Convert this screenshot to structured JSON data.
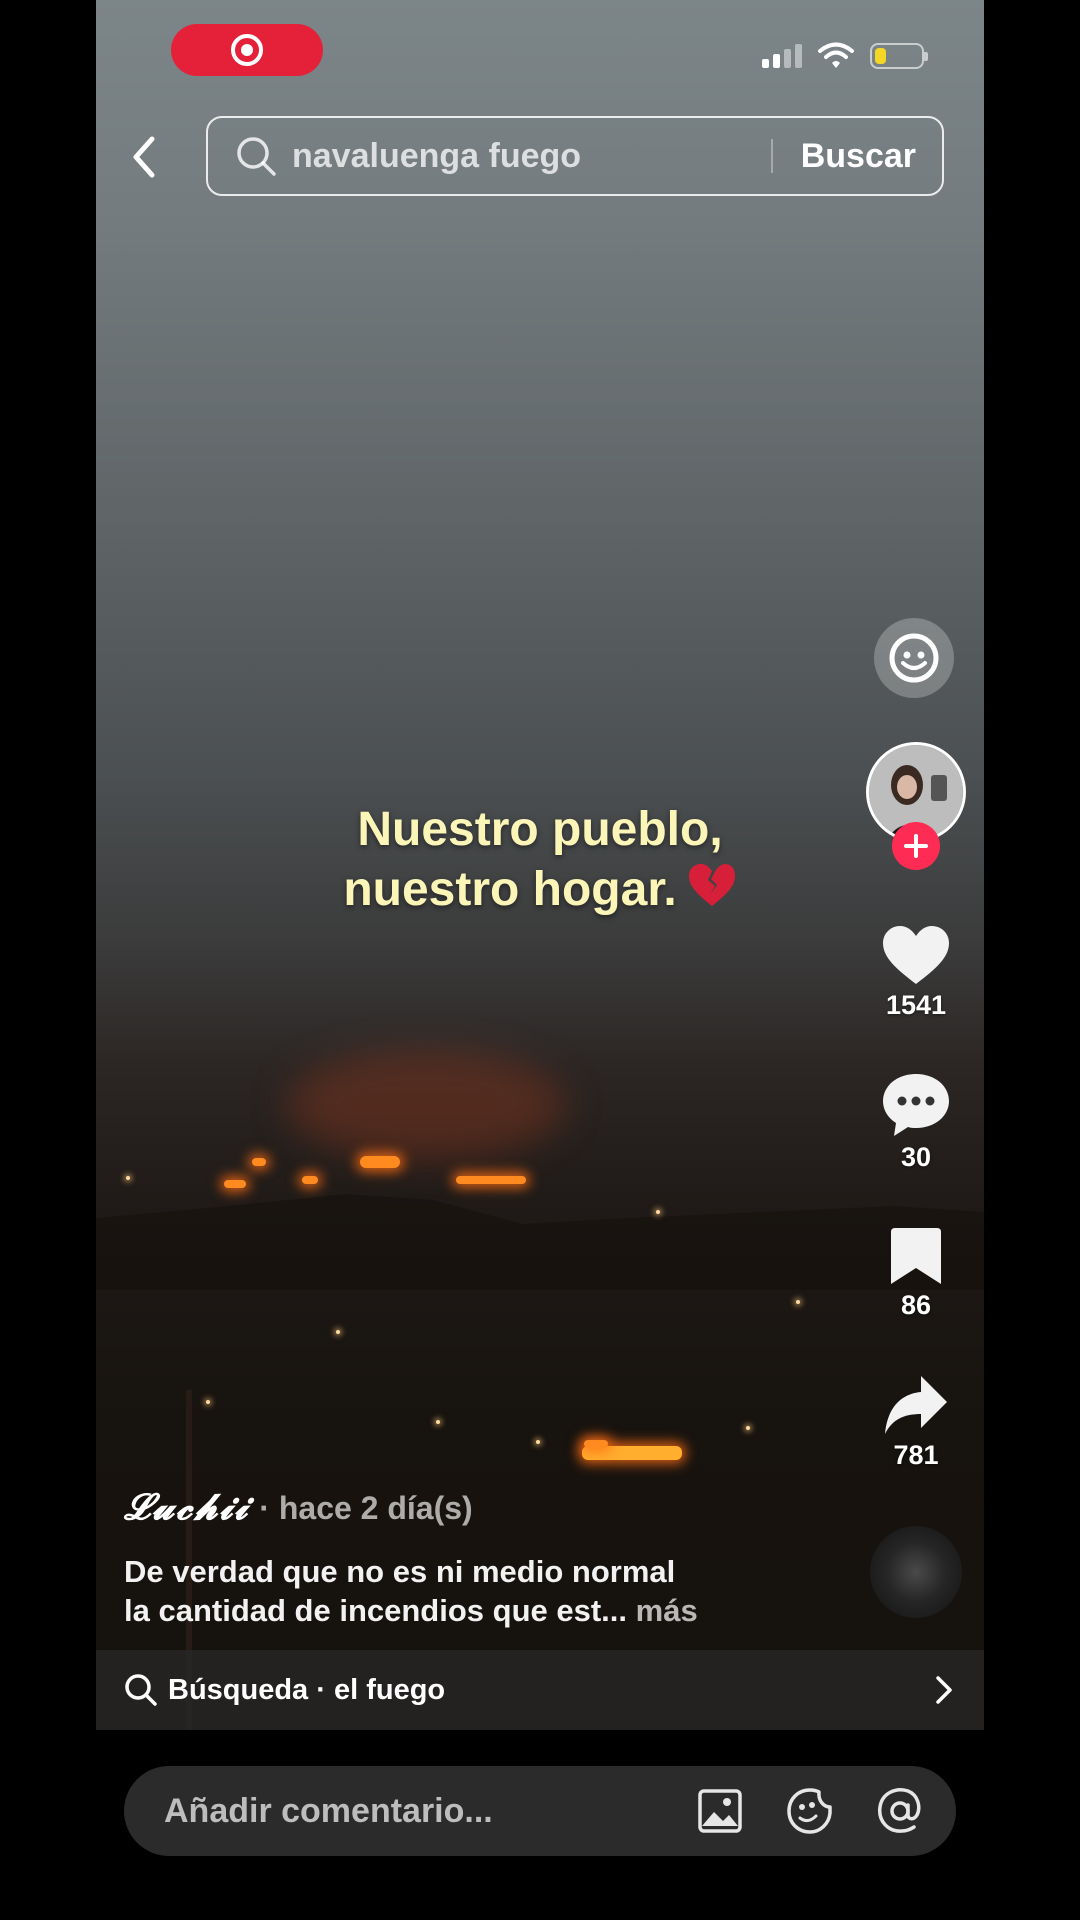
{
  "search": {
    "query": "navaluenga fuego",
    "submit_label": "Buscar"
  },
  "video": {
    "overlay_line1": "Nuestro pueblo,",
    "overlay_line2": "nuestro hogar.",
    "overlay_emoji": "💔"
  },
  "rail": {
    "likes": "1541",
    "comments": "30",
    "saves": "86",
    "shares": "781"
  },
  "post": {
    "author": "𝓛𝓾𝓬𝓱𝓲𝓲",
    "time_ago": "· hace 2 día(s)",
    "caption_line1": "De verdad que no es ni medio normal",
    "caption_line2": "la cantidad de incendios que est...",
    "more_label": "más"
  },
  "related_search": {
    "label": "Búsqueda · el fuego"
  },
  "comment_bar": {
    "placeholder": "Añadir comentario..."
  },
  "colors": {
    "recording_red": "#e5213a",
    "follow_pink": "#fe2c55",
    "overlay_text": "#fbf5b8",
    "battery_level": "#f4d627"
  },
  "status": {
    "battery_fraction": 0.25,
    "signal_bars_active": 2
  }
}
